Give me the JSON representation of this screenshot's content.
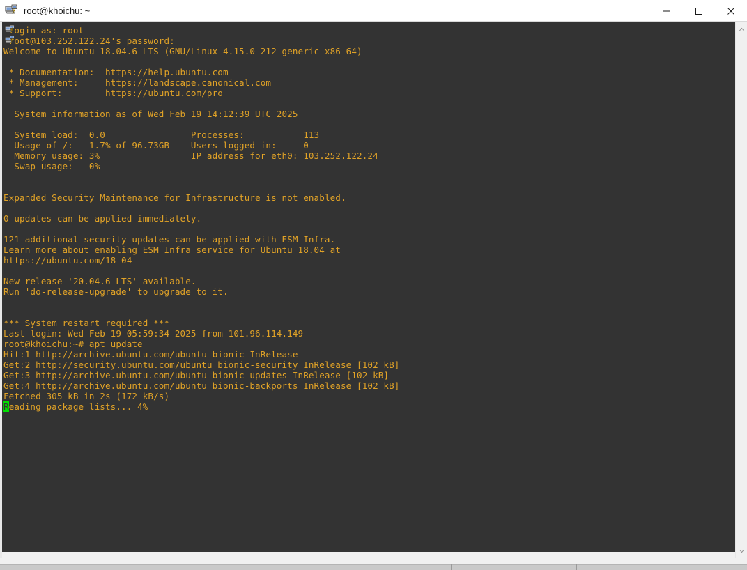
{
  "window": {
    "title": "root@khoichu: ~",
    "app_icon": "putty-icon",
    "controls": {
      "minimize": "minimize-button",
      "maximize": "maximize-button",
      "close": "close-button"
    }
  },
  "terminal": {
    "background_color": "#333333",
    "text_color": "#e0a227",
    "cursor_color": "#00e000",
    "lines": [
      " login as: root",
      " root@103.252.122.24's password:",
      "Welcome to Ubuntu 18.04.6 LTS (GNU/Linux 4.15.0-212-generic x86_64)",
      "",
      " * Documentation:  https://help.ubuntu.com",
      " * Management:     https://landscape.canonical.com",
      " * Support:        https://ubuntu.com/pro",
      "",
      "  System information as of Wed Feb 19 14:12:39 UTC 2025",
      "",
      "  System load:  0.0                Processes:           113",
      "  Usage of /:   1.7% of 96.73GB    Users logged in:     0",
      "  Memory usage: 3%                 IP address for eth0: 103.252.122.24",
      "  Swap usage:   0%",
      "",
      "",
      "Expanded Security Maintenance for Infrastructure is not enabled.",
      "",
      "0 updates can be applied immediately.",
      "",
      "121 additional security updates can be applied with ESM Infra.",
      "Learn more about enabling ESM Infra service for Ubuntu 18.04 at",
      "https://ubuntu.com/18-04",
      "",
      "New release '20.04.6 LTS' available.",
      "Run 'do-release-upgrade' to upgrade to it.",
      "",
      "",
      "*** System restart required ***",
      "Last login: Wed Feb 19 05:59:34 2025 from 101.96.114.149",
      "root@khoichu:~# apt update",
      "Hit:1 http://archive.ubuntu.com/ubuntu bionic InRelease",
      "Get:2 http://security.ubuntu.com/ubuntu bionic-security InRelease [102 kB]",
      "Get:3 http://archive.ubuntu.com/ubuntu bionic-updates InRelease [102 kB]",
      "Get:4 http://archive.ubuntu.com/ubuntu bionic-backports InRelease [102 kB]",
      "Fetched 305 kB in 2s (172 kB/s)"
    ],
    "cursor_line": {
      "cursor_char": "R",
      "rest": "eading package lists... 4%"
    }
  },
  "scrollbars": {
    "vertical": {
      "up_arrow": "scroll-up-arrow",
      "down_arrow": "scroll-down-arrow"
    },
    "horizontal": {}
  }
}
